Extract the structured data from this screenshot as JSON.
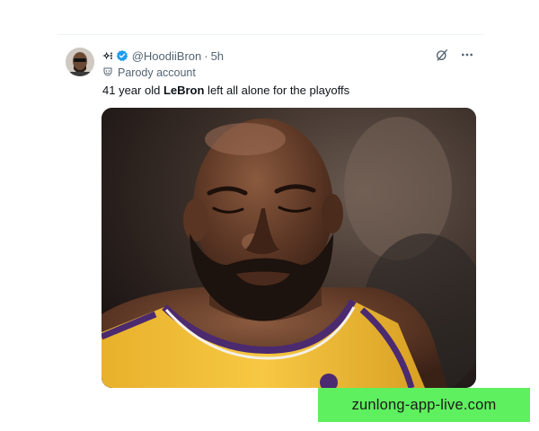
{
  "tweet": {
    "display_name_glyph": "✧⁝",
    "handle": "@HoodiiBron",
    "separator": "·",
    "timestamp": "5h",
    "parody_label": "Parody account",
    "text_before": "41 year old ",
    "text_bold": "LeBron",
    "text_after": " left all alone for the playoffs",
    "avatar_icon": "avatar-sunglasses-person",
    "verified_icon": "verified-badge-icon",
    "parody_icon": "mask-icon",
    "actions": [
      "grok-icon",
      "more-icon"
    ],
    "media_alt_icon": "photo-player-in-yellow-jersey"
  },
  "watermark": {
    "text": "zunlong-app-live.com"
  },
  "colors": {
    "verified_blue": "#1d9bf0",
    "watermark_green": "#5ef05e",
    "secondary_text": "#536471",
    "jersey_gold": "#f5c33a",
    "jersey_purple": "#5a2d82"
  }
}
